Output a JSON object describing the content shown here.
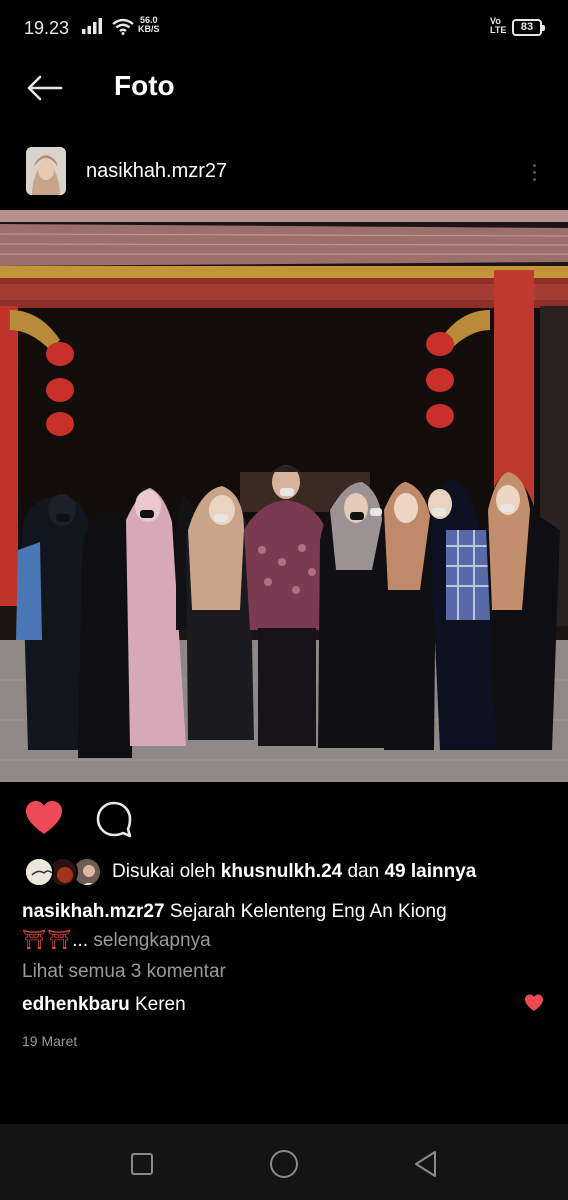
{
  "status_bar": {
    "time": "19.23",
    "speed_value": "56.0",
    "speed_unit": "KB/S",
    "volte_top": "Vo",
    "volte_bottom": "LTE",
    "battery": "83"
  },
  "app_bar": {
    "title": "Foto"
  },
  "post": {
    "username": "nasikhah.mzr27",
    "likes": {
      "prefix": "Disukai oleh ",
      "user": "khusnulkh.24",
      "middle": " dan ",
      "others": "49 lainnya"
    },
    "caption": {
      "username": "nasikhah.mzr27",
      "text": "Sejarah Kelenteng Eng An Kiong",
      "emoji": "⛩⛩",
      "ellipsis": "... ",
      "more": "selengkapnya"
    },
    "view_comments": "Lihat semua 3 komentar",
    "comment": {
      "user": "edhenkbaru",
      "text": "Keren"
    },
    "date": "19 Maret"
  },
  "colors": {
    "like_red": "#ed4956",
    "background": "#000000",
    "secondary_text": "#9a9a9a"
  },
  "icons": {
    "back": "arrow-left-icon",
    "like": "heart-icon",
    "comment": "comment-bubble-icon",
    "nav_recents": "square-icon",
    "nav_home": "circle-icon",
    "nav_back": "triangle-back-icon"
  }
}
